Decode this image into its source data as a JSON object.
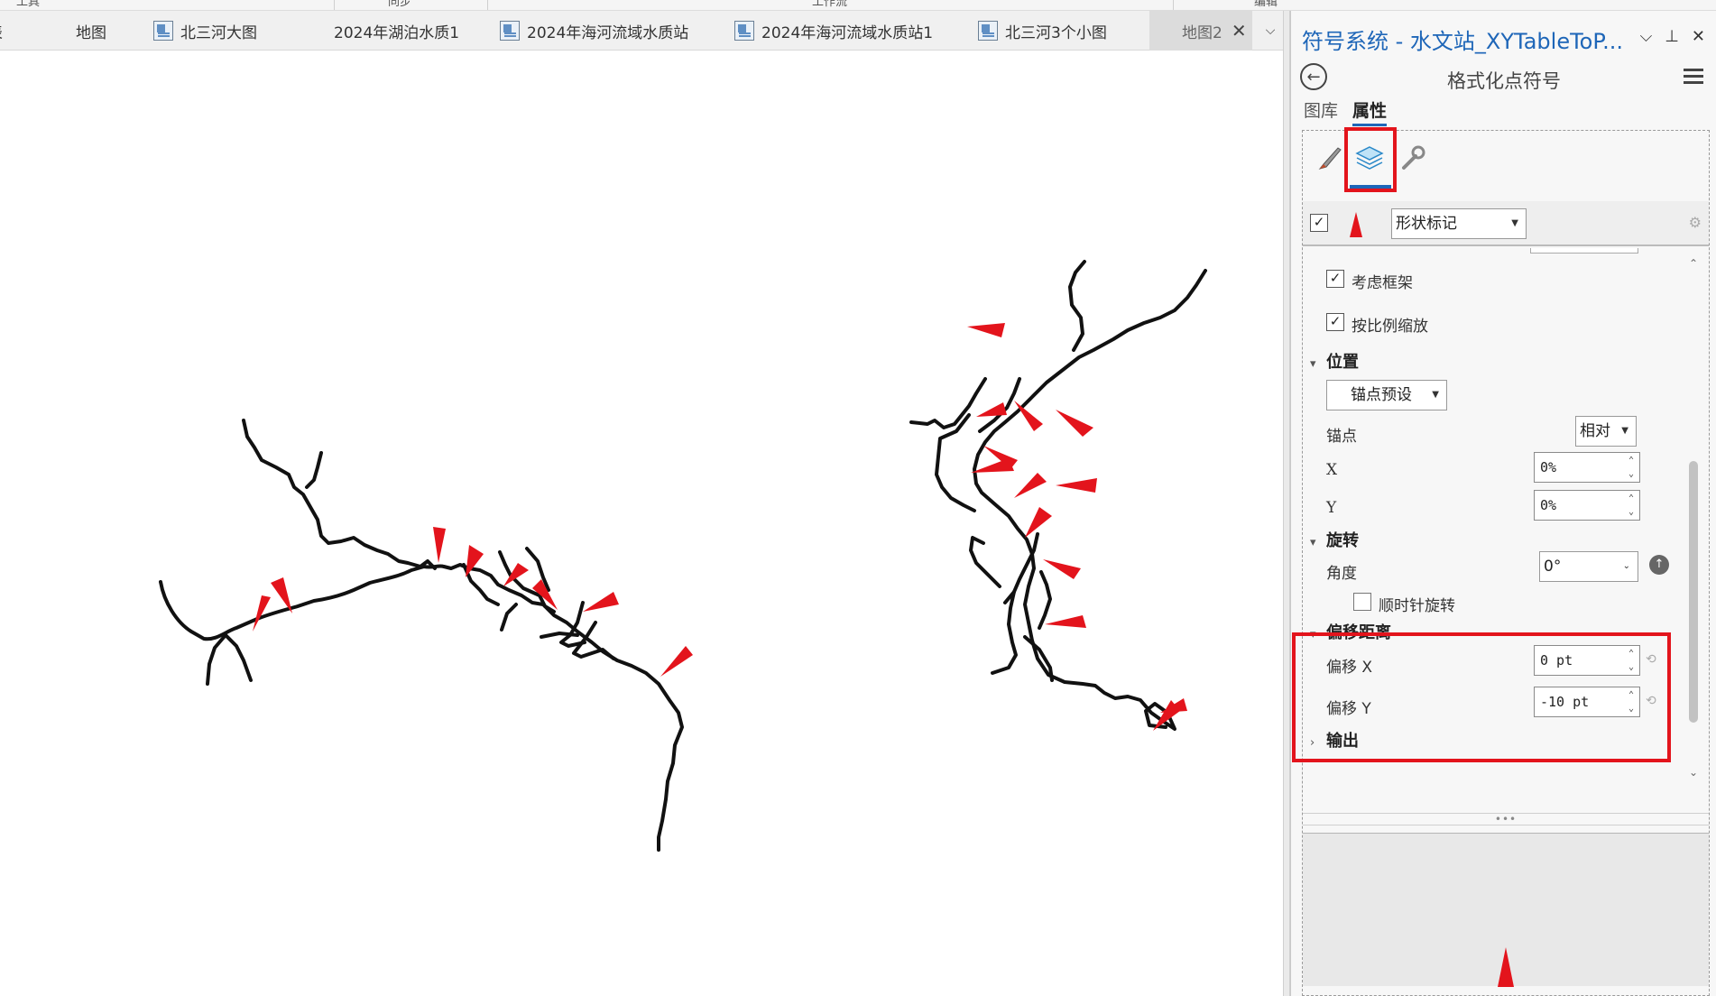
{
  "ribbon": {
    "groups": [
      "工具",
      "同步",
      "工作流",
      "编辑"
    ]
  },
  "tabs": [
    {
      "label": "表",
      "icon": "table-icon"
    },
    {
      "label": "地图",
      "icon": "map-icon"
    },
    {
      "label": "北三河大图",
      "icon": "layout-icon"
    },
    {
      "label": "2024年湖泊水质1",
      "icon": "map-icon"
    },
    {
      "label": "2024年海河流域水质站",
      "icon": "layout-icon"
    },
    {
      "label": "2024年海河流域水质站1",
      "icon": "layout-icon"
    },
    {
      "label": "北三河3个小图",
      "icon": "layout-icon"
    },
    {
      "label": "地图2",
      "icon": "map-icon",
      "active": true
    }
  ],
  "pane": {
    "title": "符号系统 - 水文站_XYTableToP...",
    "subtitle": "格式化点符号",
    "subtabs": [
      "图库",
      "属性"
    ],
    "active_subtab": "属性",
    "layer_type": "形状标记",
    "options": {
      "consider_frame": "考虑框架",
      "scale_proportionally": "按比例缩放"
    },
    "position": {
      "section": "位置",
      "anchor_preset": "锚点预设",
      "anchor_label": "锚点",
      "anchor_mode": "相对",
      "x_label": "X",
      "x_value": "0%",
      "y_label": "Y",
      "y_value": "0%"
    },
    "rotation": {
      "section": "旋转",
      "angle_label": "角度",
      "angle_value": "0°",
      "clockwise_label": "顺时针旋转"
    },
    "offset": {
      "section": "偏移距离",
      "x_label": "偏移 X",
      "x_value": "0 pt",
      "y_label": "偏移 Y",
      "y_value": "-10 pt"
    },
    "output_section": "输出"
  },
  "colors": {
    "accent": "#1e66b8",
    "highlight": "#e3141c",
    "river": "#111111"
  }
}
